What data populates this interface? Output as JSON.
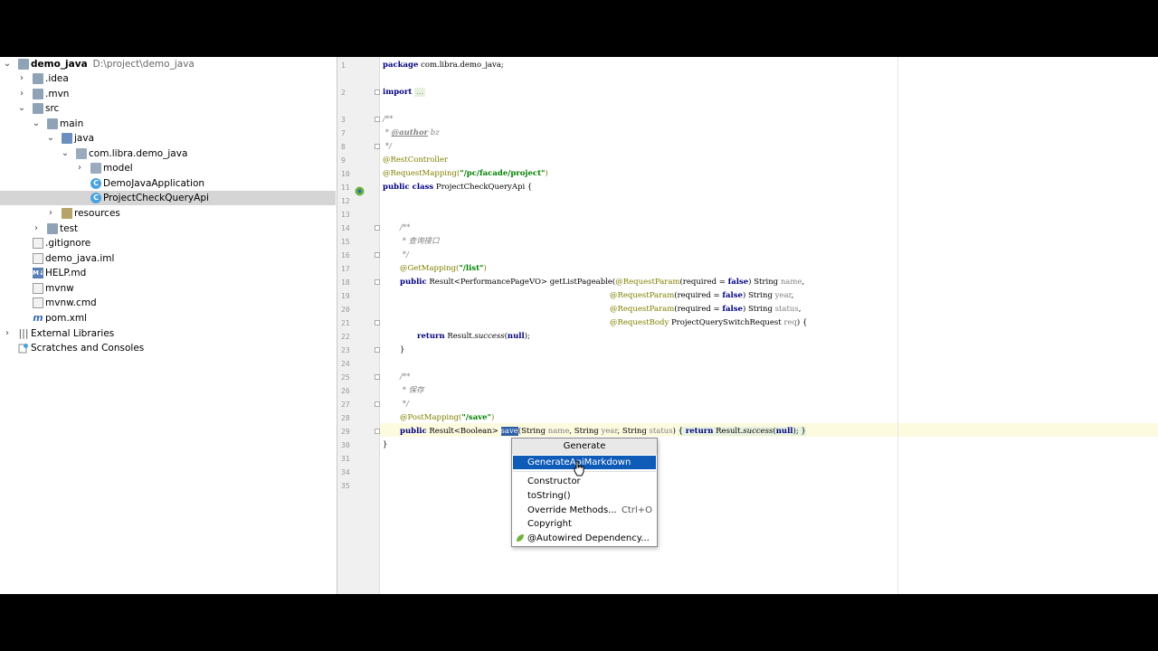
{
  "project": {
    "name": "demo_java",
    "path": "D:\\project\\demo_java"
  },
  "tree": {
    "idea": ".idea",
    "mvn": ".mvn",
    "src": "src",
    "main": "main",
    "java": "java",
    "package": "com.libra.demo_java",
    "model": "model",
    "demo_app": "DemoJavaApplication",
    "check_api": "ProjectCheckQueryApi",
    "resources": "resources",
    "test": "test",
    "gitignore": ".gitignore",
    "iml": "demo_java.iml",
    "help": "HELP.md",
    "mvnw": "mvnw",
    "mvnw_cmd": "mvnw.cmd",
    "pom": "pom.xml",
    "external_libs": "External Libraries",
    "scratches": "Scratches and Consoles"
  },
  "line_numbers": [
    "1",
    "2",
    "3",
    "7",
    "8",
    "9",
    "10",
    "11",
    "12",
    "13",
    "14",
    "15",
    "16",
    "17",
    "18",
    "19",
    "20",
    "21",
    "22",
    "23",
    "24",
    "25",
    "26",
    "27",
    "28",
    "29",
    "30",
    "31",
    "34",
    "35"
  ],
  "code": {
    "l1_kw": "package",
    "l1_rest": " com.libra.demo_java;",
    "l3_kw": "import",
    "l3_fold": "...",
    "l8": "/**",
    "l9_star": " * ",
    "l9_tag": "@author",
    "l9_rest": " bz",
    "l10": " */",
    "l11": "@RestController",
    "l12_ann": "@RequestMapping(",
    "l12_str": "\"/pc/facade/project\"",
    "l12_end": ")",
    "l13_kw": "public class",
    "l13_rest": " ProjectCheckQueryApi {",
    "l16": "/**",
    "l17": " * 查询接口",
    "l18": " */",
    "l19_ann": "@GetMapping(",
    "l19_str": "\"/list\"",
    "l19_end": ")",
    "l20_kw": "public",
    "l20_a": " Result<PerformancePageVO> getListPageable(",
    "l20_ann": "@RequestParam",
    "l20_b": "(required = ",
    "l20_false": "false",
    "l20_c": ") String ",
    "l20_p": "name",
    "l20_d": ",",
    "l21_ann": "@RequestParam",
    "l21_b": "(required = ",
    "l21_false": "false",
    "l21_c": ") String ",
    "l21_p": "year",
    "l21_d": ",",
    "l22_ann": "@RequestParam",
    "l22_b": "(required = ",
    "l22_false": "false",
    "l22_c": ") String ",
    "l22_p": "status",
    "l22_d": ",",
    "l23_ann": "@RequestBody",
    "l23_b": " ProjectQuerySwitchRequest ",
    "l23_p": "req",
    "l23_c": ") {",
    "l24_kw": "return",
    "l24_a": " Result.",
    "l24_static": "success",
    "l24_b": "(",
    "l24_null": "null",
    "l24_c": ");",
    "l25": "}",
    "l27": "/**",
    "l28": " * 保存",
    "l29": " */",
    "l30_ann": "@PostMapping(",
    "l30_str": "\"/save\"",
    "l30_end": ")",
    "l31_kw": "public",
    "l31_a": " Result<Boolean> ",
    "l31_sel": "save",
    "l31_b": "(String ",
    "l31_p1": "name",
    "l31_c": ", String ",
    "l31_p2": "year",
    "l31_d": ", String ",
    "l31_p3": "status",
    "l31_e": ") ",
    "l31_f": "{ ",
    "l31_kw2": "return",
    "l31_g": " Result.",
    "l31_static": "success",
    "l31_h": "(",
    "l31_null": "null",
    "l31_i": "); }",
    "l34": "}"
  },
  "popup": {
    "title": "Generate",
    "items": {
      "generate_api_markdown": "GenerateApiMarkdown",
      "constructor": "Constructor",
      "tostring": "toString()",
      "override": "Override Methods...",
      "override_shortcut": "Ctrl+O",
      "copyright": "Copyright",
      "autowired": "@Autowired Dependency..."
    }
  },
  "colors": {
    "keyword": "#000080",
    "string": "#008000",
    "annotation": "#808000",
    "comment": "#808080",
    "selection": "#0e5bb8"
  }
}
